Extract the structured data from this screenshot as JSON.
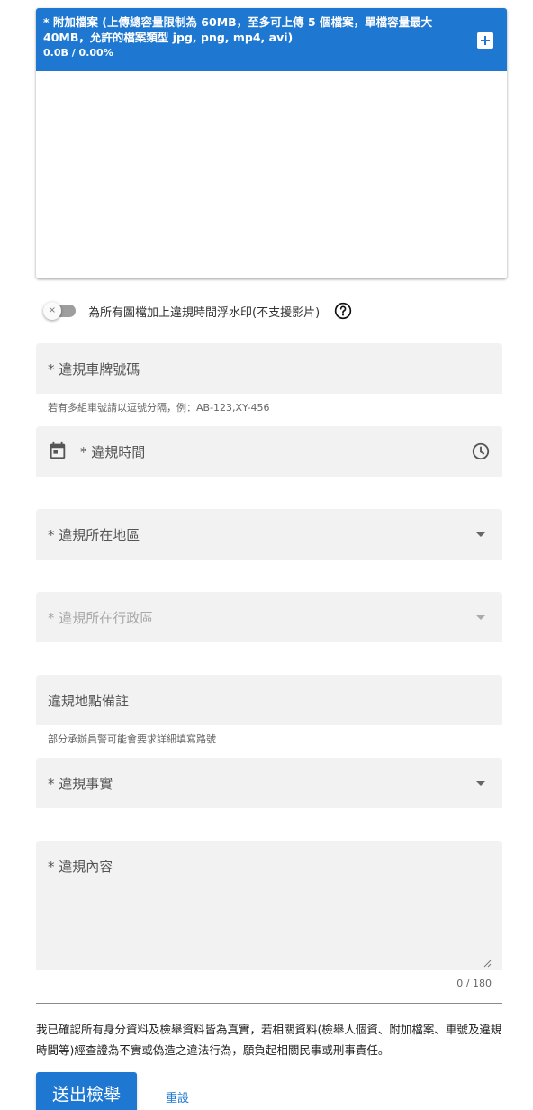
{
  "upload": {
    "title": "* 附加檔案 (上傳總容量限制為 60MB，至多可上傳 5 個檔案，單檔容量最大 40MB，允許的檔案類型 jpg, png, mp4, avi)",
    "progress": "0.0B / 0.00%",
    "add_icon": "plus-icon",
    "accent": "#1e78d2"
  },
  "watermark_toggle": {
    "label": "為所有圖檔加上違規時間浮水印(不支援影片)",
    "state": "off",
    "knob_glyph": "×",
    "help_icon": "question-circle-icon"
  },
  "fields": {
    "plate": {
      "label": "* 違規車牌號碼",
      "hint": "若有多組車號請以逗號分隔，例：AB-123,XY-456"
    },
    "time": {
      "label": "* 違規時間",
      "left_icon": "calendar-icon",
      "right_icon": "clock-icon"
    },
    "region": {
      "label": "* 違規所在地區"
    },
    "district": {
      "label": "* 違規所在行政區"
    },
    "location_note": {
      "label": "違規地點備註",
      "hint": "部分承辦員警可能會要求詳細填寫路號"
    },
    "violation_fact": {
      "label": "* 違規事實"
    },
    "content": {
      "label": "* 違規內容",
      "counter": "0 / 180"
    }
  },
  "declaration": "我已確認所有身分資料及檢舉資料皆為真實，若相關資料(檢舉人個資、附加檔案、車號及違規時間等)經查證為不實或偽造之違法行為，願負起相關民事或刑事責任。",
  "actions": {
    "submit": "送出檢舉",
    "reset": "重設"
  }
}
